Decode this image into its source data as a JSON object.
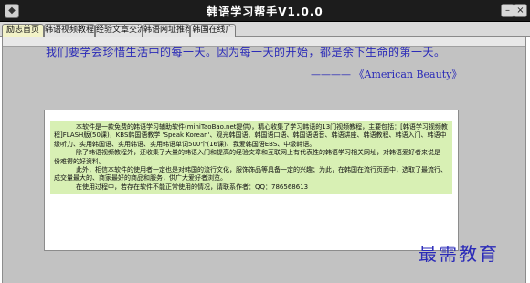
{
  "window": {
    "title": "韩语学习帮手V1.0.0",
    "minimize_glyph": "–",
    "close_glyph": "×"
  },
  "tabs": [
    {
      "label": "励志首页",
      "active": true
    },
    {
      "label": "韩语视频教程",
      "active": false
    },
    {
      "label": "经验文章交流",
      "active": false
    },
    {
      "label": "韩语网址推荐",
      "active": false
    },
    {
      "label": "韩国在线广",
      "active": false
    }
  ],
  "quote": {
    "text": "我们要学会珍惜生活中的每一天。因为每一天的开始，都是余下生命的第一天。",
    "source": "———— 《American Beauty》"
  },
  "intro": {
    "paragraphs": [
      "本软件是一款免费的韩语学习辅助软件(miniTaoBao.net提供)，精心收集了学习韩语的13门视频教程，主要包括：[韩语学习视频教程]FLASH版(50课)，KBS韩国语教学 'Speak Korean'、观光韩国语、韩国语口语、韩国语语音、韩语讲座、韩语教程、韩语入门、韩语中级听力、实用韩国语、实用韩语、实用韩语单词500个(16课)、我爱韩国语EBS、中级韩语。",
      "除了韩语视频教程外，还收集了大量的韩语入门和提高的经验文章和互联网上有代表性的韩语学习相关网址，对韩语爱好者来说是一份难得的好资料。",
      "此外，相信本软件的使用者一定也是对韩国的流行文化，服饰饰品等具备一定的兴趣；为此，在韩国在流行页面中，选取了最流行、成交量最大的、商家最好的商品和服务，供广大爱好者浏览。",
      "在使用过程中，若存在软件不能正常使用的情况，请联系作者：QQ：786568613"
    ]
  },
  "watermark": "最需教育",
  "colors": {
    "titlebar": "#1c1c1c",
    "quote_text": "#2a2ab8",
    "content_bg": "#c2c2c2",
    "text_highlight": "#d8f0b4",
    "active_tab": "#f2f2c8"
  }
}
